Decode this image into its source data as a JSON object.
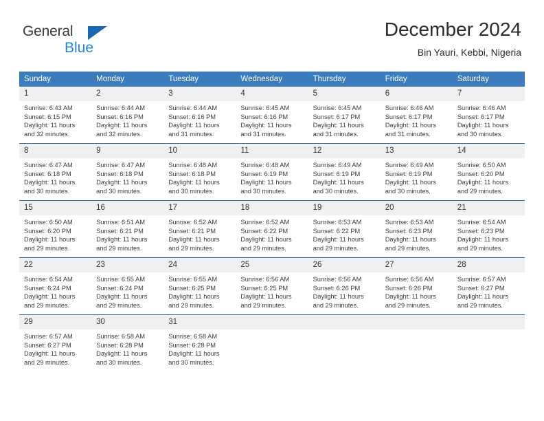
{
  "brand": {
    "name_top": "General",
    "name_bottom": "Blue",
    "accent_color": "#1668b3",
    "accent_color_light": "#1c87e0"
  },
  "header": {
    "title": "December 2024",
    "subtitle": "Bin Yauri, Kebbi, Nigeria"
  },
  "theme": {
    "header_row_bg": "#3a7cbe",
    "daynum_bg": "#f0f0f0",
    "week_divider": "#2e6da4",
    "text": "#3c3c3c"
  },
  "labels": {
    "sunrise_prefix": "Sunrise:",
    "sunset_prefix": "Sunset:",
    "daylight_prefix": "Daylight:"
  },
  "weekday_headers": [
    "Sunday",
    "Monday",
    "Tuesday",
    "Wednesday",
    "Thursday",
    "Friday",
    "Saturday"
  ],
  "weeks": [
    [
      {
        "day": "1",
        "sunrise": "Sunrise: 6:43 AM",
        "sunset": "Sunset: 6:15 PM",
        "daylight_1": "Daylight: 11 hours",
        "daylight_2": "and 32 minutes."
      },
      {
        "day": "2",
        "sunrise": "Sunrise: 6:44 AM",
        "sunset": "Sunset: 6:16 PM",
        "daylight_1": "Daylight: 11 hours",
        "daylight_2": "and 32 minutes."
      },
      {
        "day": "3",
        "sunrise": "Sunrise: 6:44 AM",
        "sunset": "Sunset: 6:16 PM",
        "daylight_1": "Daylight: 11 hours",
        "daylight_2": "and 31 minutes."
      },
      {
        "day": "4",
        "sunrise": "Sunrise: 6:45 AM",
        "sunset": "Sunset: 6:16 PM",
        "daylight_1": "Daylight: 11 hours",
        "daylight_2": "and 31 minutes."
      },
      {
        "day": "5",
        "sunrise": "Sunrise: 6:45 AM",
        "sunset": "Sunset: 6:17 PM",
        "daylight_1": "Daylight: 11 hours",
        "daylight_2": "and 31 minutes."
      },
      {
        "day": "6",
        "sunrise": "Sunrise: 6:46 AM",
        "sunset": "Sunset: 6:17 PM",
        "daylight_1": "Daylight: 11 hours",
        "daylight_2": "and 31 minutes."
      },
      {
        "day": "7",
        "sunrise": "Sunrise: 6:46 AM",
        "sunset": "Sunset: 6:17 PM",
        "daylight_1": "Daylight: 11 hours",
        "daylight_2": "and 30 minutes."
      }
    ],
    [
      {
        "day": "8",
        "sunrise": "Sunrise: 6:47 AM",
        "sunset": "Sunset: 6:18 PM",
        "daylight_1": "Daylight: 11 hours",
        "daylight_2": "and 30 minutes."
      },
      {
        "day": "9",
        "sunrise": "Sunrise: 6:47 AM",
        "sunset": "Sunset: 6:18 PM",
        "daylight_1": "Daylight: 11 hours",
        "daylight_2": "and 30 minutes."
      },
      {
        "day": "10",
        "sunrise": "Sunrise: 6:48 AM",
        "sunset": "Sunset: 6:18 PM",
        "daylight_1": "Daylight: 11 hours",
        "daylight_2": "and 30 minutes."
      },
      {
        "day": "11",
        "sunrise": "Sunrise: 6:48 AM",
        "sunset": "Sunset: 6:19 PM",
        "daylight_1": "Daylight: 11 hours",
        "daylight_2": "and 30 minutes."
      },
      {
        "day": "12",
        "sunrise": "Sunrise: 6:49 AM",
        "sunset": "Sunset: 6:19 PM",
        "daylight_1": "Daylight: 11 hours",
        "daylight_2": "and 30 minutes."
      },
      {
        "day": "13",
        "sunrise": "Sunrise: 6:49 AM",
        "sunset": "Sunset: 6:19 PM",
        "daylight_1": "Daylight: 11 hours",
        "daylight_2": "and 30 minutes."
      },
      {
        "day": "14",
        "sunrise": "Sunrise: 6:50 AM",
        "sunset": "Sunset: 6:20 PM",
        "daylight_1": "Daylight: 11 hours",
        "daylight_2": "and 29 minutes."
      }
    ],
    [
      {
        "day": "15",
        "sunrise": "Sunrise: 6:50 AM",
        "sunset": "Sunset: 6:20 PM",
        "daylight_1": "Daylight: 11 hours",
        "daylight_2": "and 29 minutes."
      },
      {
        "day": "16",
        "sunrise": "Sunrise: 6:51 AM",
        "sunset": "Sunset: 6:21 PM",
        "daylight_1": "Daylight: 11 hours",
        "daylight_2": "and 29 minutes."
      },
      {
        "day": "17",
        "sunrise": "Sunrise: 6:52 AM",
        "sunset": "Sunset: 6:21 PM",
        "daylight_1": "Daylight: 11 hours",
        "daylight_2": "and 29 minutes."
      },
      {
        "day": "18",
        "sunrise": "Sunrise: 6:52 AM",
        "sunset": "Sunset: 6:22 PM",
        "daylight_1": "Daylight: 11 hours",
        "daylight_2": "and 29 minutes."
      },
      {
        "day": "19",
        "sunrise": "Sunrise: 6:53 AM",
        "sunset": "Sunset: 6:22 PM",
        "daylight_1": "Daylight: 11 hours",
        "daylight_2": "and 29 minutes."
      },
      {
        "day": "20",
        "sunrise": "Sunrise: 6:53 AM",
        "sunset": "Sunset: 6:23 PM",
        "daylight_1": "Daylight: 11 hours",
        "daylight_2": "and 29 minutes."
      },
      {
        "day": "21",
        "sunrise": "Sunrise: 6:54 AM",
        "sunset": "Sunset: 6:23 PM",
        "daylight_1": "Daylight: 11 hours",
        "daylight_2": "and 29 minutes."
      }
    ],
    [
      {
        "day": "22",
        "sunrise": "Sunrise: 6:54 AM",
        "sunset": "Sunset: 6:24 PM",
        "daylight_1": "Daylight: 11 hours",
        "daylight_2": "and 29 minutes."
      },
      {
        "day": "23",
        "sunrise": "Sunrise: 6:55 AM",
        "sunset": "Sunset: 6:24 PM",
        "daylight_1": "Daylight: 11 hours",
        "daylight_2": "and 29 minutes."
      },
      {
        "day": "24",
        "sunrise": "Sunrise: 6:55 AM",
        "sunset": "Sunset: 6:25 PM",
        "daylight_1": "Daylight: 11 hours",
        "daylight_2": "and 29 minutes."
      },
      {
        "day": "25",
        "sunrise": "Sunrise: 6:56 AM",
        "sunset": "Sunset: 6:25 PM",
        "daylight_1": "Daylight: 11 hours",
        "daylight_2": "and 29 minutes."
      },
      {
        "day": "26",
        "sunrise": "Sunrise: 6:56 AM",
        "sunset": "Sunset: 6:26 PM",
        "daylight_1": "Daylight: 11 hours",
        "daylight_2": "and 29 minutes."
      },
      {
        "day": "27",
        "sunrise": "Sunrise: 6:56 AM",
        "sunset": "Sunset: 6:26 PM",
        "daylight_1": "Daylight: 11 hours",
        "daylight_2": "and 29 minutes."
      },
      {
        "day": "28",
        "sunrise": "Sunrise: 6:57 AM",
        "sunset": "Sunset: 6:27 PM",
        "daylight_1": "Daylight: 11 hours",
        "daylight_2": "and 29 minutes."
      }
    ],
    [
      {
        "day": "29",
        "sunrise": "Sunrise: 6:57 AM",
        "sunset": "Sunset: 6:27 PM",
        "daylight_1": "Daylight: 11 hours",
        "daylight_2": "and 29 minutes."
      },
      {
        "day": "30",
        "sunrise": "Sunrise: 6:58 AM",
        "sunset": "Sunset: 6:28 PM",
        "daylight_1": "Daylight: 11 hours",
        "daylight_2": "and 30 minutes."
      },
      {
        "day": "31",
        "sunrise": "Sunrise: 6:58 AM",
        "sunset": "Sunset: 6:28 PM",
        "daylight_1": "Daylight: 11 hours",
        "daylight_2": "and 30 minutes."
      },
      {
        "day": "",
        "sunrise": "",
        "sunset": "",
        "daylight_1": "",
        "daylight_2": ""
      },
      {
        "day": "",
        "sunrise": "",
        "sunset": "",
        "daylight_1": "",
        "daylight_2": ""
      },
      {
        "day": "",
        "sunrise": "",
        "sunset": "",
        "daylight_1": "",
        "daylight_2": ""
      },
      {
        "day": "",
        "sunrise": "",
        "sunset": "",
        "daylight_1": "",
        "daylight_2": ""
      }
    ]
  ]
}
